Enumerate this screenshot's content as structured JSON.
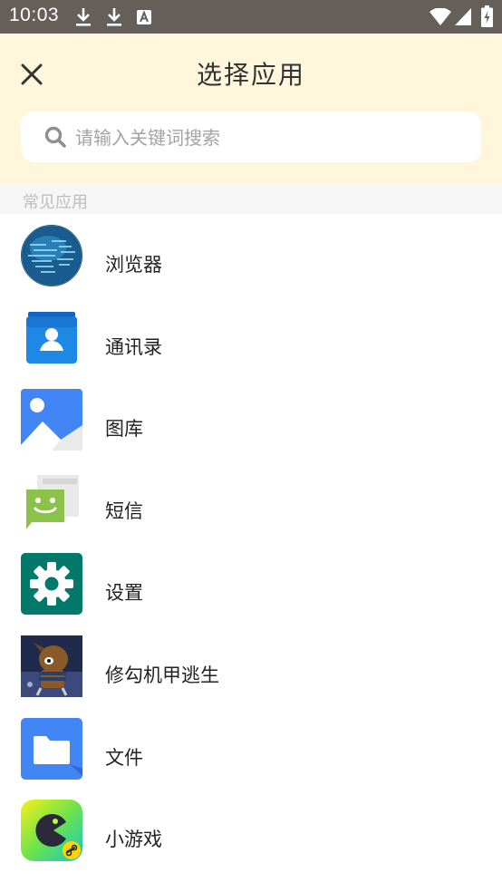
{
  "status_bar": {
    "time": "10:03",
    "left_icons": [
      "download-icon",
      "download-icon",
      "text-notification-icon"
    ],
    "right_icons": [
      "wifi-icon",
      "signal-icon",
      "battery-charging-icon"
    ]
  },
  "header": {
    "title": "选择应用",
    "close_icon": "close-icon"
  },
  "search": {
    "placeholder": "请输入关键词搜索",
    "icon": "search-icon"
  },
  "section": {
    "label": "常见应用"
  },
  "apps": [
    {
      "label": "浏览器",
      "icon": "browser-globe-icon"
    },
    {
      "label": "通讯录",
      "icon": "contacts-icon"
    },
    {
      "label": "图库",
      "icon": "gallery-icon"
    },
    {
      "label": "短信",
      "icon": "messaging-icon"
    },
    {
      "label": "设置",
      "icon": "settings-gear-icon"
    },
    {
      "label": "修勾机甲逃生",
      "icon": "game-dog-icon"
    },
    {
      "label": "文件",
      "icon": "folder-icon"
    },
    {
      "label": "小游戏",
      "icon": "mini-game-icon"
    }
  ],
  "colors": {
    "status_bar_bg": "#646059",
    "header_bg": "#fff7dc",
    "section_bg": "#f6f6f6"
  }
}
